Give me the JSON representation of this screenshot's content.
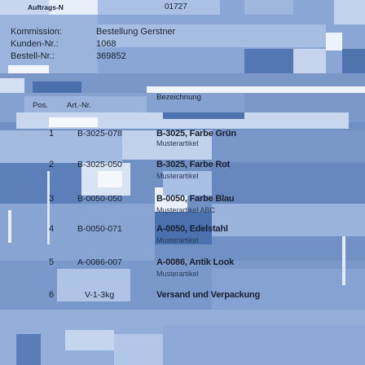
{
  "header": {
    "auftrags_label": "Auftrags-N",
    "auftrags_value": "01727",
    "kommission_label": "Kommission:",
    "kommission_value": "Bestellung Gerstner",
    "kunden_label": "Kunden-Nr.:",
    "kunden_value": "1068",
    "bestell_label": "Bestell-Nr.:",
    "bestell_value": "369852"
  },
  "table": {
    "columns": [
      "Pos.",
      "Art.-Nr.",
      "Bezeichnung"
    ],
    "rows": [
      {
        "pos": "1",
        "art": "B-3025-078",
        "name": "B-3025, Farbe Grün",
        "sub": "Musterartikel"
      },
      {
        "pos": "2",
        "art": "B-3025-050",
        "name": "B-3025, Farbe Rot",
        "sub": "Musterartikel"
      },
      {
        "pos": "3",
        "art": "B-0050-050",
        "name": "B-0050, Farbe Blau",
        "sub": "Musterartikel ABC"
      },
      {
        "pos": "4",
        "art": "B-0050-071",
        "name": "A-0050, Edelstahl",
        "sub": "Musterartikel"
      },
      {
        "pos": "5",
        "art": "A-0086-007",
        "name": "A-0086, Antik Look",
        "sub": "Musterartikel"
      },
      {
        "pos": "6",
        "art": "V-1-3kg",
        "name": "Versand und Verpackung",
        "sub": ""
      }
    ]
  },
  "colors": {
    "background": "#6f8fc2",
    "tile_light": "#b9cbe6",
    "tile_white": "#ffffff",
    "tile_dark": "#4d72ad"
  }
}
